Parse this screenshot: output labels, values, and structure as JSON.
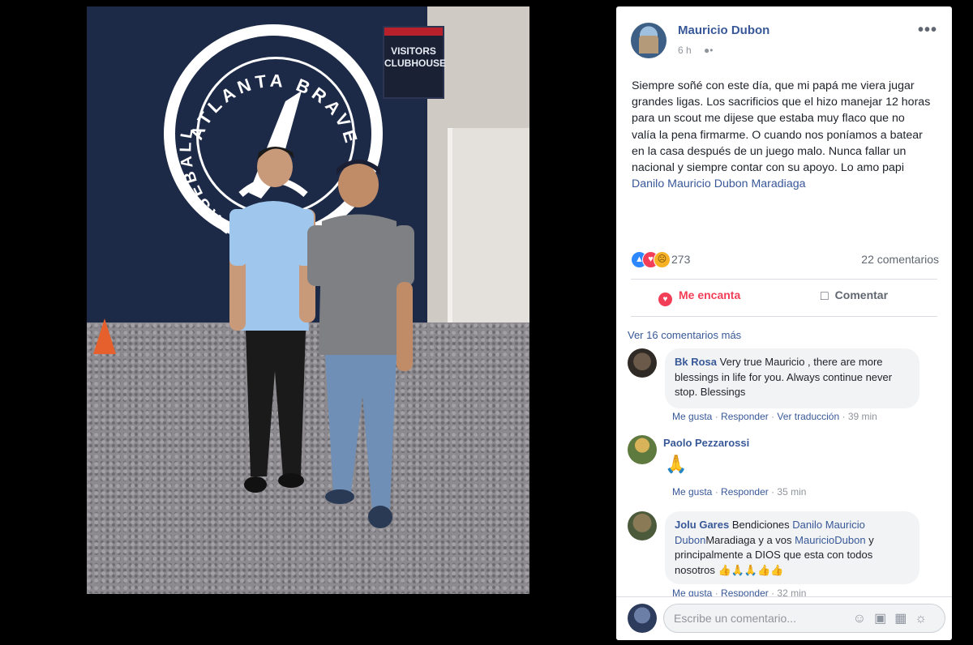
{
  "photo": {
    "logo_top": "ATLANTA BRAVES",
    "logo_left": "BASEBALL",
    "sign": "VISITORS CLUBHOUSE"
  },
  "post": {
    "author": "Mauricio Dubon",
    "time": "6 h",
    "audience_icon": "friends-icon",
    "more_label": "•••",
    "body_text": "Siempre soñé con este día, que mi papá me viera jugar grandes ligas. Los sacrificios que el hizo manejar 12 horas para un scout me dijese que estaba muy flaco que no valía la pena firmarme. O cuando nos poníamos a batear en la casa después de un juego malo. Nunca fallar un nacional y siempre contar con su apoyo. Lo amo papi ",
    "body_tag": "Danilo Mauricio Dubon Maradiaga",
    "reaction_count": "273",
    "comment_count": "22 comentarios",
    "reactions": [
      "like-icon",
      "love-icon",
      "sad-icon"
    ],
    "actions": {
      "love": "Me encanta",
      "comment": "Comentar"
    },
    "more_comments": "Ver 16 comentarios más"
  },
  "comments": [
    {
      "name": "Bk Rosa",
      "text": "Very true Mauricio , there are more blessings in life for you. Always continue never stop. Blessings",
      "like": "Me gusta",
      "reply": "Responder",
      "translate": "Ver traducción",
      "time": "39 min"
    },
    {
      "name": "Paolo Pezzarossi",
      "emoji": "🙏",
      "like": "Me gusta",
      "reply": "Responder",
      "time": "35 min"
    },
    {
      "name": "Jolu Gares",
      "text_before": "Bendiciones ",
      "link1": "Danilo Mauricio Dubon",
      "text_middle": "Maradiaga y a vos ",
      "link2": "MauricioDubon",
      "text_after": " y principalmente a DIOS que esta con todos nosotros ",
      "emojis": "👍🙏🙏👍👍",
      "like": "Me gusta",
      "reply": "Responder",
      "time": "32 min"
    }
  ],
  "composer": {
    "placeholder": "Escribe un comentario...",
    "icons": [
      "emoji-icon",
      "camera-icon",
      "gif-icon",
      "sticker-icon"
    ]
  },
  "colors": {
    "link": "#385898",
    "love": "#f33e58",
    "like": "#2d88ff",
    "banner_navy": "#1d2a47"
  }
}
